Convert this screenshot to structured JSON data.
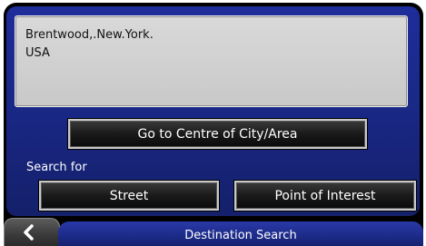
{
  "location": {
    "line1": "Brentwood,.New.York.",
    "line2": "USA"
  },
  "buttons": {
    "centre_label": "Go to Centre of City/Area",
    "street_label": "Street",
    "poi_label": "Point of Interest"
  },
  "search_for_label": "Search for",
  "footer": {
    "back_icon": "back-chevron-icon",
    "title": "Destination Search"
  },
  "colors": {
    "panel_blue": "#1a2888",
    "location_box": "#d0d0d0",
    "button_dark": "#1a1a1a",
    "button_border": "#c9c9c9",
    "title_tab": "#1c2a88"
  }
}
